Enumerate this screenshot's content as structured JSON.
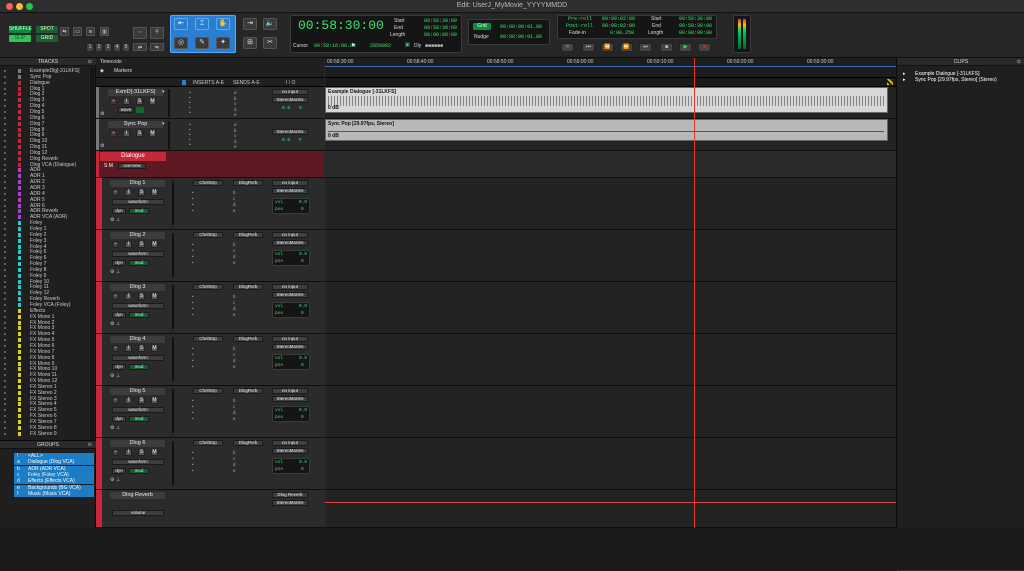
{
  "window": {
    "title": "Edit: UserJ_MyMovie_YYYYMMDD"
  },
  "colors": {
    "green": "#0e8a3c",
    "counter": "#3ce46c",
    "accent": "#2a7fd0",
    "red": "#c6283a",
    "playhead": "#e33"
  },
  "toolbar": {
    "modes": [
      "SHUFFLE",
      "SPOT",
      "SLIP",
      "GRID"
    ],
    "numbers": [
      "1",
      "2",
      "3",
      "4",
      "5"
    ],
    "counter": "00:58:30:00",
    "start_label": "Start",
    "end_label": "End",
    "length_label": "Length",
    "start": "00:58:30:00",
    "end": "00:58:30:00",
    "length": "00:00:00:00",
    "cursor_label": "Cursor",
    "cursor": "00:59:16:06.81",
    "cursor_samples": "2859902",
    "grid_label": "Grid",
    "grid": "00:00:00:01.00",
    "nudge_label": "Nudge",
    "nudge": "00:00:00:01.00",
    "dly": "Dly",
    "preroll_label": "Pre-roll",
    "postroll_label": "Post-roll",
    "fadein_label": "Fade-in",
    "preroll": "00:00:02:00",
    "postroll": "00:00:02:00",
    "fadein": "0:00.250",
    "t_start": "00:58:30:00",
    "t_end": "00:58:30:00",
    "t_length": "00:00:00:00"
  },
  "tracks_panel": {
    "header": "TRACKS",
    "items": [
      {
        "name": "ExampleDlg[-31LKFS]",
        "color": "#7a7a7a"
      },
      {
        "name": "Sync Pop",
        "color": "#7a7a7a"
      },
      {
        "name": "Dialogue",
        "color": "#c6283a"
      },
      {
        "name": "Dlog 1",
        "color": "#c6283a"
      },
      {
        "name": "Dlog 2",
        "color": "#c6283a"
      },
      {
        "name": "Dlog 3",
        "color": "#c6283a"
      },
      {
        "name": "Dlog 4",
        "color": "#c6283a"
      },
      {
        "name": "Dlog 5",
        "color": "#c6283a"
      },
      {
        "name": "Dlog 6",
        "color": "#c6283a"
      },
      {
        "name": "Dlog 7",
        "color": "#c6283a"
      },
      {
        "name": "Dlog 8",
        "color": "#c6283a"
      },
      {
        "name": "Dlog 9",
        "color": "#c6283a"
      },
      {
        "name": "Dlog 10",
        "color": "#c6283a"
      },
      {
        "name": "Dlog 11",
        "color": "#c6283a"
      },
      {
        "name": "Dlog 12",
        "color": "#c6283a"
      },
      {
        "name": "Dlog Reverb",
        "color": "#c6283a"
      },
      {
        "name": "Dlog VCA (Dialogue)",
        "color": "#c6283a"
      },
      {
        "name": "ADR",
        "color": "#b040d0"
      },
      {
        "name": "ADR 1",
        "color": "#b040d0"
      },
      {
        "name": "ADR 2",
        "color": "#b040d0"
      },
      {
        "name": "ADR 3",
        "color": "#b040d0"
      },
      {
        "name": "ADR 4",
        "color": "#b040d0"
      },
      {
        "name": "ADR 5",
        "color": "#b040d0"
      },
      {
        "name": "ADR 6",
        "color": "#b040d0"
      },
      {
        "name": "ADR Reverb",
        "color": "#b040d0"
      },
      {
        "name": "ADR VCA (ADR)",
        "color": "#b040d0"
      },
      {
        "name": "Foley",
        "color": "#28c8c8"
      },
      {
        "name": "Foley 1",
        "color": "#28c8c8"
      },
      {
        "name": "Foley 2",
        "color": "#28c8c8"
      },
      {
        "name": "Foley 3",
        "color": "#28c8c8"
      },
      {
        "name": "Foley 4",
        "color": "#28c8c8"
      },
      {
        "name": "Foley 5",
        "color": "#28c8c8"
      },
      {
        "name": "Foley 6",
        "color": "#28c8c8"
      },
      {
        "name": "Foley 7",
        "color": "#28c8c8"
      },
      {
        "name": "Foley 8",
        "color": "#28c8c8"
      },
      {
        "name": "Foley 9",
        "color": "#28c8c8"
      },
      {
        "name": "Foley 10",
        "color": "#28c8c8"
      },
      {
        "name": "Foley 11",
        "color": "#28c8c8"
      },
      {
        "name": "Foley 12",
        "color": "#28c8c8"
      },
      {
        "name": "Foley Reverb",
        "color": "#28c8c8"
      },
      {
        "name": "Foley VCA (Foley)",
        "color": "#28c8c8"
      },
      {
        "name": "Effects",
        "color": "#d8d030"
      },
      {
        "name": "FX Mono 1",
        "color": "#d8d030"
      },
      {
        "name": "FX Mono 2",
        "color": "#d8d030"
      },
      {
        "name": "FX Mono 3",
        "color": "#d8d030"
      },
      {
        "name": "FX Mono 4",
        "color": "#d8d030"
      },
      {
        "name": "FX Mono 5",
        "color": "#d8d030"
      },
      {
        "name": "FX Mono 6",
        "color": "#d8d030"
      },
      {
        "name": "FX Mono 7",
        "color": "#d8d030"
      },
      {
        "name": "FX Mono 8",
        "color": "#d8d030"
      },
      {
        "name": "FX Mono 9",
        "color": "#d8d030"
      },
      {
        "name": "FX Mono 10",
        "color": "#d8d030"
      },
      {
        "name": "FX Mono 11",
        "color": "#d8d030"
      },
      {
        "name": "FX Mono 12",
        "color": "#d8d030"
      },
      {
        "name": "FX Stereo 1",
        "color": "#d8d030"
      },
      {
        "name": "FX Stereo 2",
        "color": "#d8d030"
      },
      {
        "name": "FX Stereo 3",
        "color": "#d8d030"
      },
      {
        "name": "FX Stereo 4",
        "color": "#d8d030"
      },
      {
        "name": "FX Stereo 5",
        "color": "#d8d030"
      },
      {
        "name": "FX Stereo 6",
        "color": "#d8d030"
      },
      {
        "name": "FX Stereo 7",
        "color": "#d8d030"
      },
      {
        "name": "FX Stereo 8",
        "color": "#d8d030"
      },
      {
        "name": "FX Stereo 9",
        "color": "#d8d030"
      }
    ]
  },
  "groups_panel": {
    "header": "GROUPS",
    "items": [
      {
        "id": "!",
        "name": "<ALL>"
      },
      {
        "id": "a",
        "name": "Dialogue (Dlog VCA)"
      },
      {
        "id": "b",
        "name": "ADR (ADR VCA)"
      },
      {
        "id": "c",
        "name": "Foley (Foley VCA)"
      },
      {
        "id": "d",
        "name": "Effects (Effects VCA)"
      },
      {
        "id": "e",
        "name": "Backgrounds (BG VCA)"
      },
      {
        "id": "f",
        "name": "Music (Music VCA)"
      }
    ]
  },
  "rulers": {
    "timecode": "Timecode",
    "markers": "Markers",
    "ticks": [
      "00:58:30:00",
      "00:58:40:00",
      "00:58:50:00",
      "00:59:00:00",
      "00:59:10:00",
      "00:59:20:00",
      "00:59:30:00"
    ]
  },
  "columns": {
    "inserts": "INSERTS A-E",
    "sends": "SENDS A-E",
    "io": "I / O"
  },
  "edit_tracks": [
    {
      "name": "ExmD[-31LKFS]",
      "view": "wave",
      "input": "no input",
      "output": "StereoMontrs",
      "vol": "0.0",
      "pan": "0",
      "clip": "Example Dialogue [-31LKFS]",
      "clip_db": "0 dB"
    },
    {
      "name": "Sync Pop",
      "input": "",
      "output": "StereoMontrs",
      "vol": "0.0",
      "pan": "P",
      "pan2": "P",
      "clip": "Sync Pop [29.97fps, Stereo]",
      "clip_db": "0 dB"
    }
  ],
  "folder": {
    "name": "Dialogue",
    "view": "overview"
  },
  "dlog_tracks": [
    {
      "name": "Dlog 1",
      "insert": "ChnlStrp",
      "send": "DlogRvrb",
      "input": "no input",
      "output": "StereoMontrs",
      "view": "waveform",
      "dyn": "dyn",
      "mod": "mod",
      "vol": "0.0",
      "pan": "0",
      "vol_label": "vol",
      "pan_label": "pos"
    },
    {
      "name": "Dlog 2",
      "insert": "ChnlStrp",
      "send": "DlogRvrb",
      "input": "no input",
      "output": "StereoMontrs",
      "view": "waveform",
      "dyn": "dyn",
      "mod": "mod",
      "vol": "0.0",
      "pan": "0",
      "vol_label": "vol",
      "pan_label": "pos"
    },
    {
      "name": "Dlog 3",
      "insert": "ChnlStrp",
      "send": "DlogRvrb",
      "input": "no input",
      "output": "StereoMontrs",
      "view": "waveform",
      "dyn": "dyn",
      "mod": "mod",
      "vol": "0.0",
      "pan": "0",
      "vol_label": "vol",
      "pan_label": "pos"
    },
    {
      "name": "Dlog 4",
      "insert": "ChnlStrp",
      "send": "DlogRvrb",
      "input": "no input",
      "output": "StereoMontrs",
      "view": "waveform",
      "dyn": "dyn",
      "mod": "mod",
      "vol": "0.0",
      "pan": "0",
      "vol_label": "vol",
      "pan_label": "pos"
    },
    {
      "name": "Dlog 5",
      "insert": "ChnlStrp",
      "send": "DlogRvrb",
      "input": "no input",
      "output": "StereoMontrs",
      "view": "waveform",
      "dyn": "dyn",
      "mod": "mod",
      "vol": "0.0",
      "pan": "0",
      "vol_label": "vol",
      "pan_label": "pos"
    },
    {
      "name": "Dlog 6",
      "insert": "ChnlStrp",
      "send": "DlogRvrb",
      "input": "no input",
      "output": "StereoMontrs",
      "view": "waveform",
      "dyn": "dyn",
      "mod": "mod",
      "vol": "0.0",
      "pan": "0",
      "vol_label": "vol",
      "pan_label": "pos"
    }
  ],
  "reverb": {
    "name": "Dlog Reverb",
    "input": "Dlog Reverb",
    "output": "StereoMontrs",
    "view": "volume"
  },
  "send_letters": [
    "a",
    "b",
    "c",
    "d",
    "e"
  ],
  "clips_panel": {
    "header": "CLIPS",
    "items": [
      "Example Dialogue [-31LKFS]",
      "Sync Pop [29.97fps, Stereo] (Stereo)"
    ]
  }
}
